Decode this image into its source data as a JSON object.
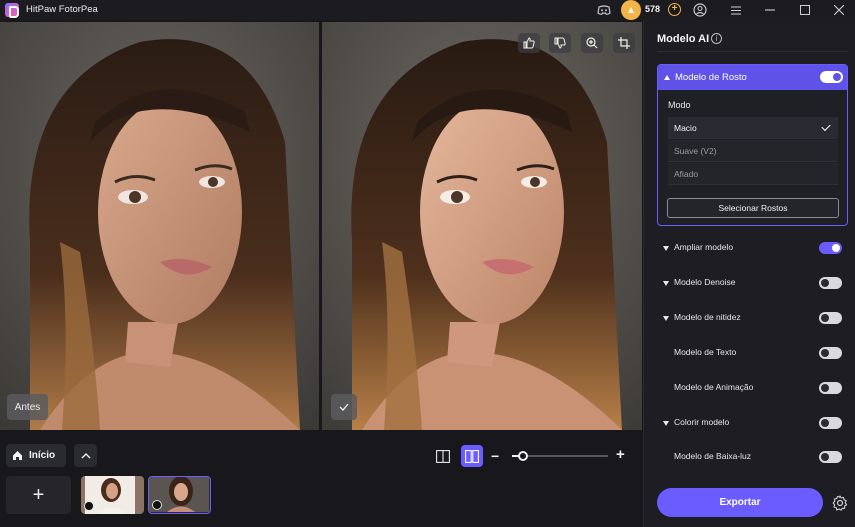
{
  "app": {
    "title": "HitPaw FotorPea"
  },
  "titlebar": {
    "credits": "578"
  },
  "canvas": {
    "before_label": "Antes"
  },
  "bottom": {
    "home_label": "Início",
    "add_label": "+"
  },
  "panel": {
    "title": "Modelo AI",
    "face_model": {
      "label": "Modelo de Rosto",
      "enabled": true,
      "mode_label": "Modo",
      "options": [
        "Macio",
        "Suave (V2)",
        "Afiado"
      ],
      "selected": "Macio",
      "select_faces_label": "Selecionar Rostos"
    },
    "models": [
      {
        "label": "Ampliar modelo",
        "enabled": true,
        "expandable": true
      },
      {
        "label": "Modelo Denoise",
        "enabled": false,
        "expandable": true
      },
      {
        "label": "Modelo de nitidez",
        "enabled": false,
        "expandable": true
      },
      {
        "label": "Modelo de Texto",
        "enabled": false,
        "expandable": false
      },
      {
        "label": "Modelo de Animação",
        "enabled": false,
        "expandable": false
      },
      {
        "label": "Colorir modelo",
        "enabled": false,
        "expandable": true
      },
      {
        "label": "Modelo de Baixa-luz",
        "enabled": false,
        "expandable": false
      }
    ],
    "export_label": "Exportar"
  },
  "colors": {
    "accent": "#6a5cff",
    "accent_header": "#5e52e8",
    "coin": "#f3b449",
    "background": "#17171c"
  },
  "zoom": {
    "level_fraction": 0.1
  }
}
